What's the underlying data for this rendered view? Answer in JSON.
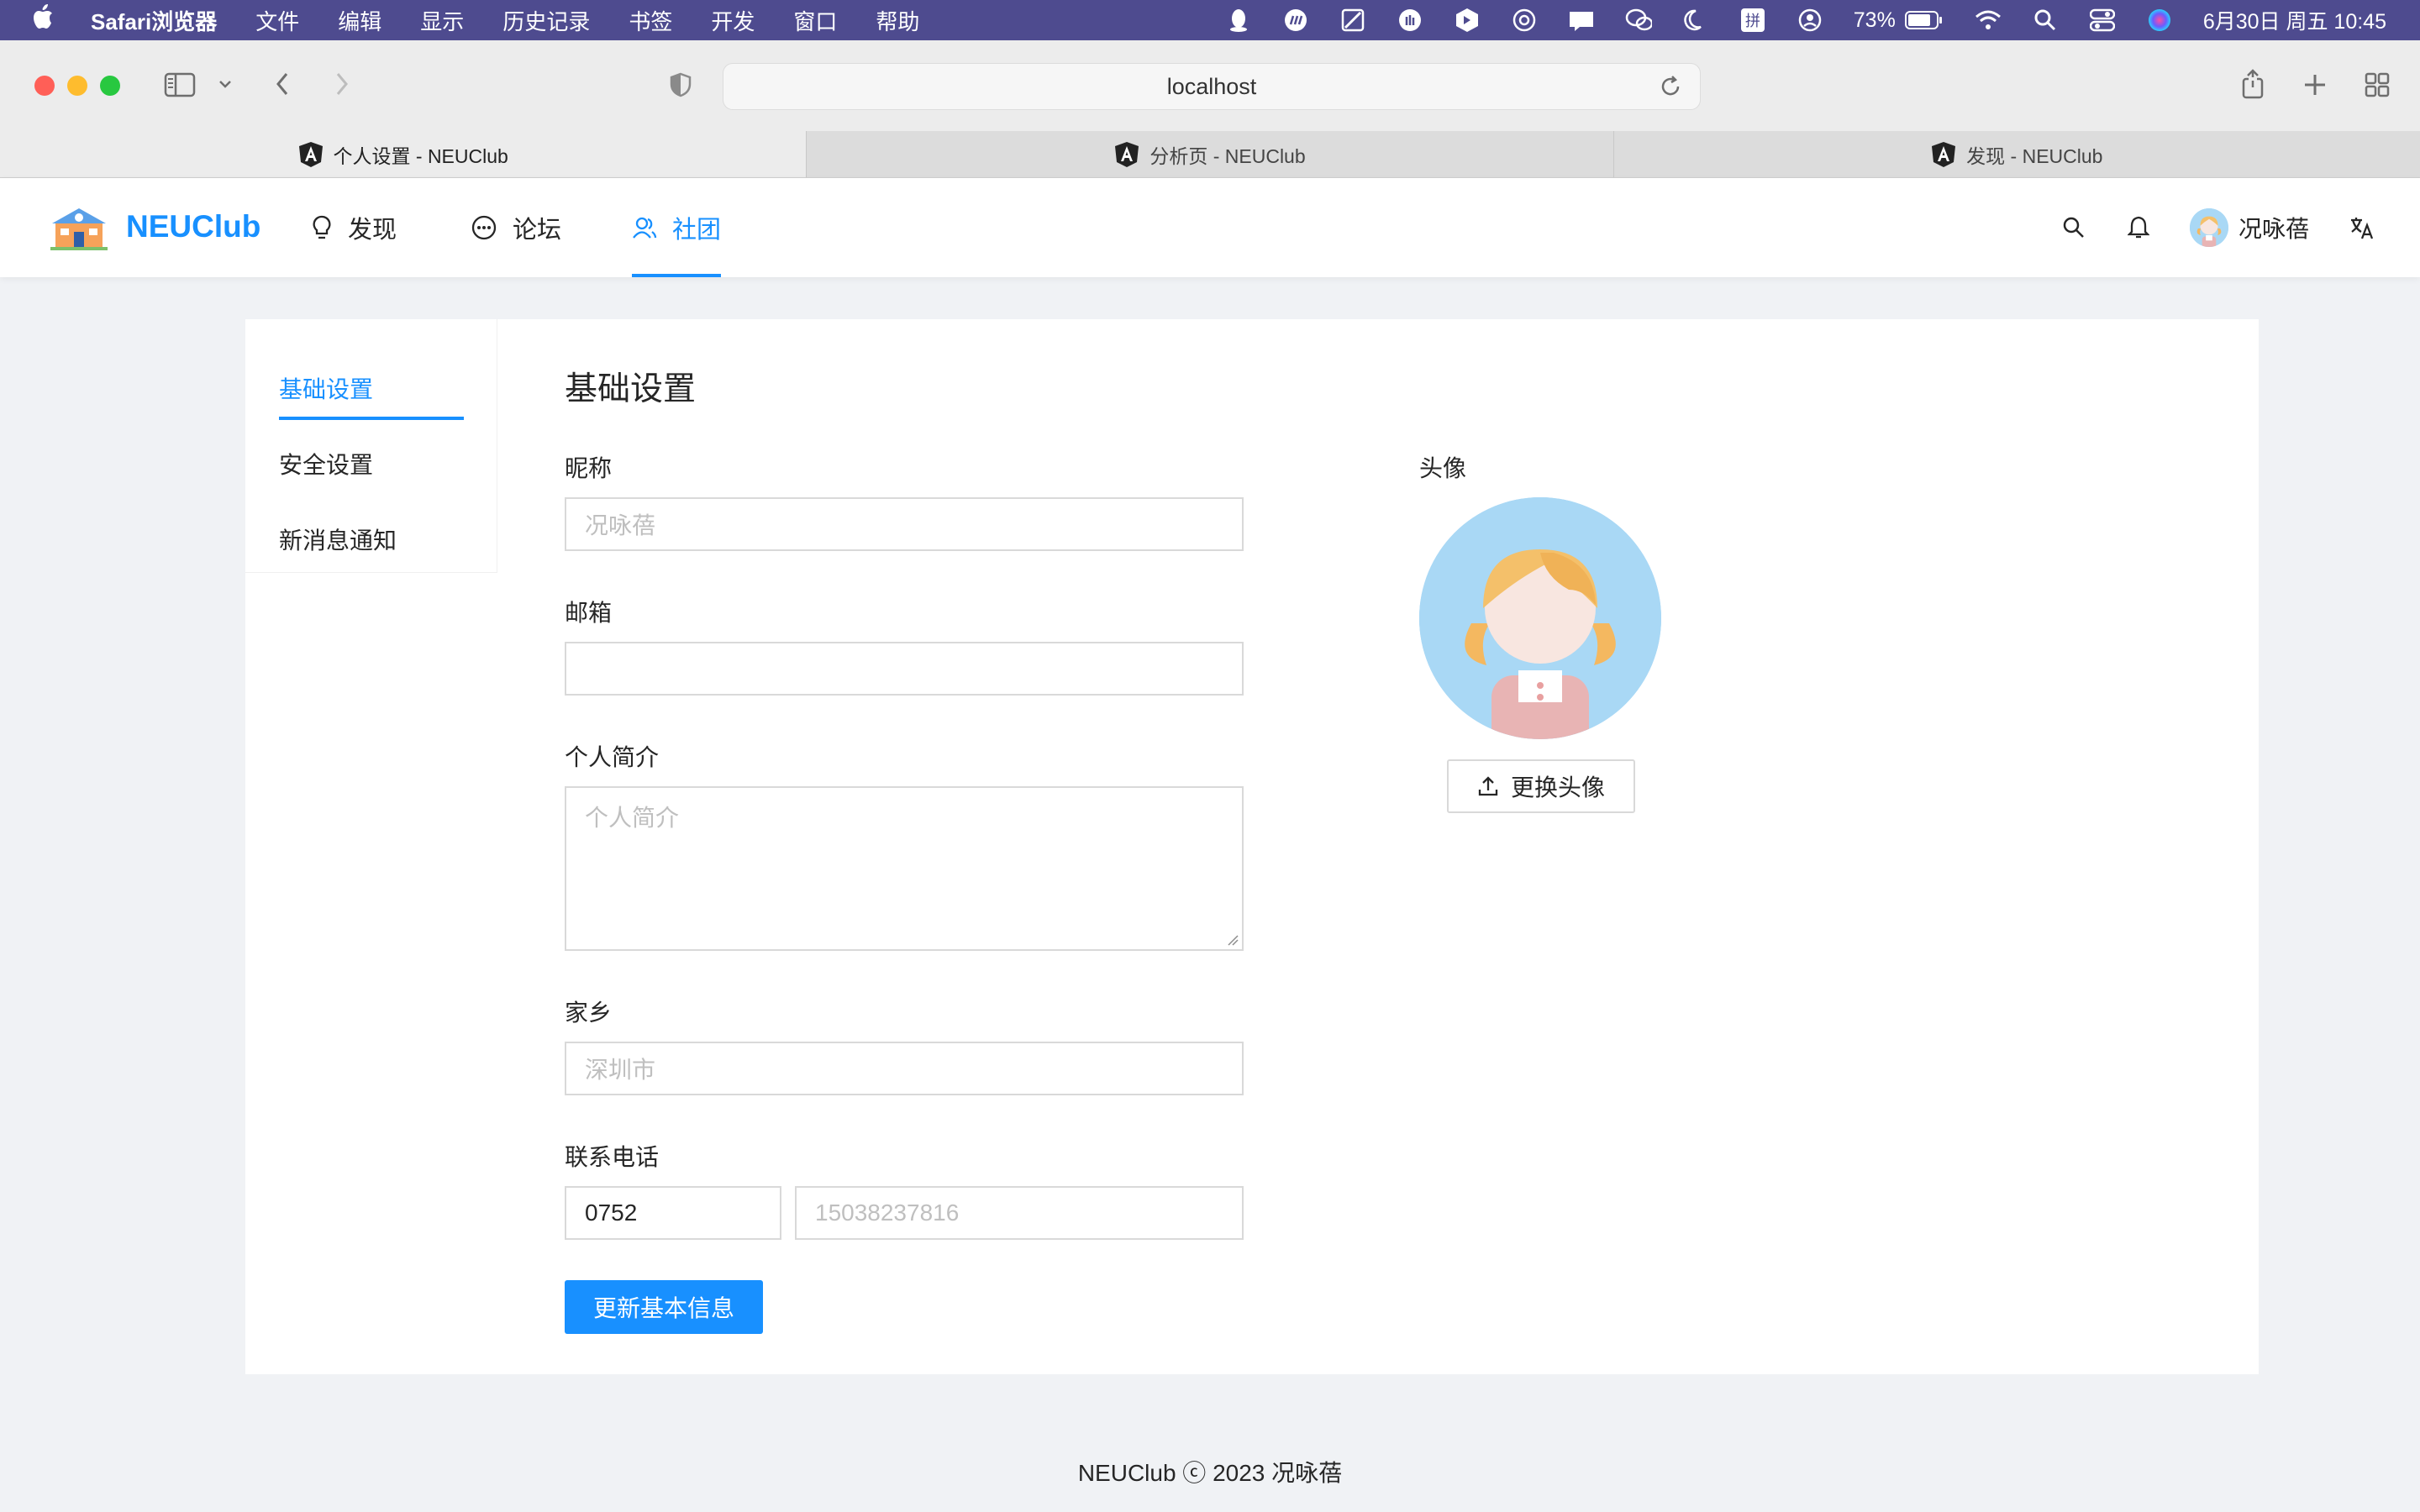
{
  "menubar": {
    "items": [
      "Safari浏览器",
      "文件",
      "编辑",
      "显示",
      "历史记录",
      "书签",
      "开发",
      "窗口",
      "帮助"
    ],
    "battery": "73%",
    "datetime": "6月30日 周五  10:45"
  },
  "browser": {
    "url": "localhost",
    "tabs": [
      {
        "title": "个人设置 - NEUClub",
        "active": true
      },
      {
        "title": "分析页 - NEUClub",
        "active": false
      },
      {
        "title": "发现 - NEUClub",
        "active": false
      }
    ]
  },
  "header": {
    "brand": "NEUClub",
    "nav": [
      {
        "label": "发现",
        "icon": "bulb-icon"
      },
      {
        "label": "论坛",
        "icon": "message-icon"
      },
      {
        "label": "社团",
        "icon": "team-icon",
        "active": true
      }
    ],
    "username": "况咏蓓"
  },
  "sidemenu": {
    "items": [
      "基础设置",
      "安全设置",
      "新消息通知"
    ],
    "active": "基础设置"
  },
  "form": {
    "title": "基础设置",
    "nickname": {
      "label": "昵称",
      "placeholder": "况咏蓓"
    },
    "email": {
      "label": "邮箱",
      "value": ""
    },
    "bio": {
      "label": "个人简介",
      "placeholder": "个人简介"
    },
    "hometown": {
      "label": "家乡",
      "placeholder": "深圳市"
    },
    "phone": {
      "label": "联系电话",
      "area_code": "0752",
      "number_placeholder": "15038237816"
    },
    "submit": "更新基本信息"
  },
  "avatar": {
    "label": "头像",
    "upload": "更换头像"
  },
  "footer": {
    "text": "NEUClub ⓒ 2023 况咏蓓"
  },
  "colors": {
    "primary": "#1890ff",
    "menubar": "#4e4b8f",
    "page_bg": "#f0f2f5"
  }
}
